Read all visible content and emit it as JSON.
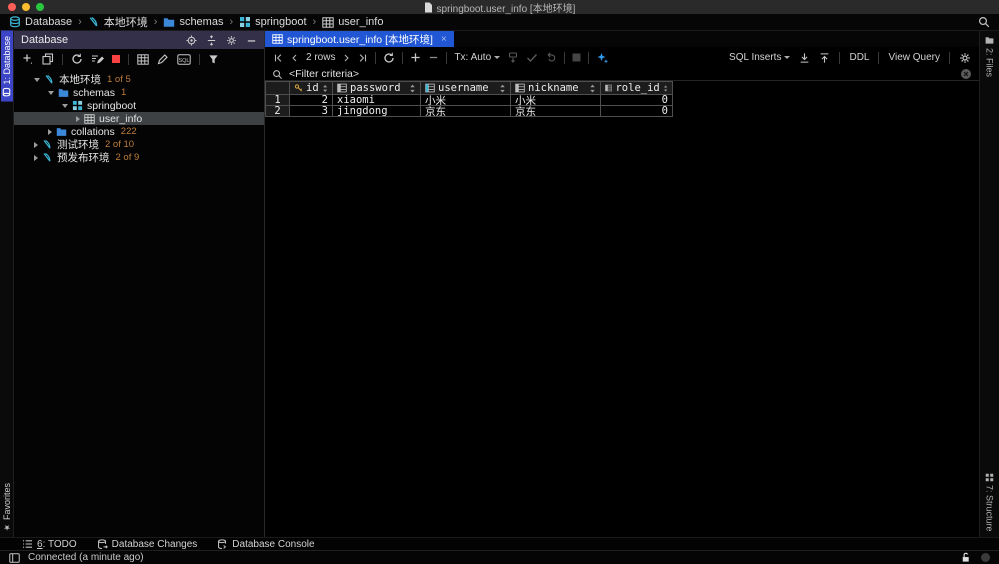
{
  "title_bar": {
    "title": "springboot.user_info [本地环境]"
  },
  "breadcrumbs": {
    "separator": "›",
    "items": [
      {
        "label": "Database",
        "icon": "database-icon"
      },
      {
        "label": "本地环境",
        "icon": "mysql-connection-icon"
      },
      {
        "label": "schemas",
        "icon": "folder-icon"
      },
      {
        "label": "springboot",
        "icon": "schema-icon"
      },
      {
        "label": "user_info",
        "icon": "table-icon"
      }
    ]
  },
  "left_stripe": {
    "database_tab": "1: Database",
    "favorites_tab": "Favorites"
  },
  "right_stripe": {
    "files_tab": "2: Files",
    "structure_tab": "7: Structure"
  },
  "db_panel": {
    "title": "Database",
    "tree": [
      {
        "label": "本地环境",
        "count": "1 of 5",
        "icon": "mysql-connection-icon"
      },
      {
        "label": "schemas",
        "count": "1",
        "icon": "folder-icon"
      },
      {
        "label": "springboot",
        "count": "",
        "icon": "schema-icon"
      },
      {
        "label": "user_info",
        "count": "",
        "icon": "table-icon"
      },
      {
        "label": "collations",
        "count": "222",
        "icon": "folder-icon"
      },
      {
        "label": "测试环境",
        "count": "2 of 10",
        "icon": "mysql-connection-icon"
      },
      {
        "label": "预发布环境",
        "count": "2 of 9",
        "icon": "mysql-connection-icon"
      }
    ]
  },
  "editor": {
    "tab": {
      "label": "springboot.user_info [本地环境]",
      "close": "×"
    },
    "toolbar": {
      "rows_label": "2 rows",
      "tx_label": "Tx: Auto",
      "sql_inserts_label": "SQL Inserts",
      "ddl_label": "DDL",
      "view_query_label": "View Query"
    },
    "filter": {
      "text": "<Filter criteria>"
    },
    "grid": {
      "columns": [
        "id",
        "password",
        "username",
        "nickname",
        "role_id"
      ],
      "rows": [
        {
          "num": "1",
          "cells": [
            "2",
            "xiaomi",
            "小米",
            "小米",
            "0"
          ]
        },
        {
          "num": "2",
          "cells": [
            "3",
            "jingdong",
            "京东",
            "京东",
            "0"
          ]
        }
      ]
    }
  },
  "bottom_bar": {
    "todo_key": "6",
    "todo_rest": ": TODO",
    "db_changes": "Database Changes",
    "db_console": "Database Console"
  },
  "status_bar": {
    "message": "Connected (a minute ago)"
  },
  "colors": {
    "accent_tab": "#2156d4",
    "stripe_selected": "#3c45c5",
    "count_orange": "#bf7d3c",
    "tree_selection": "#3e4143",
    "folder_blue": "#3b87d8",
    "connection_cyan": "#3ab7d6",
    "key_gold": "#d9a743",
    "stop_red": "#f64242"
  }
}
